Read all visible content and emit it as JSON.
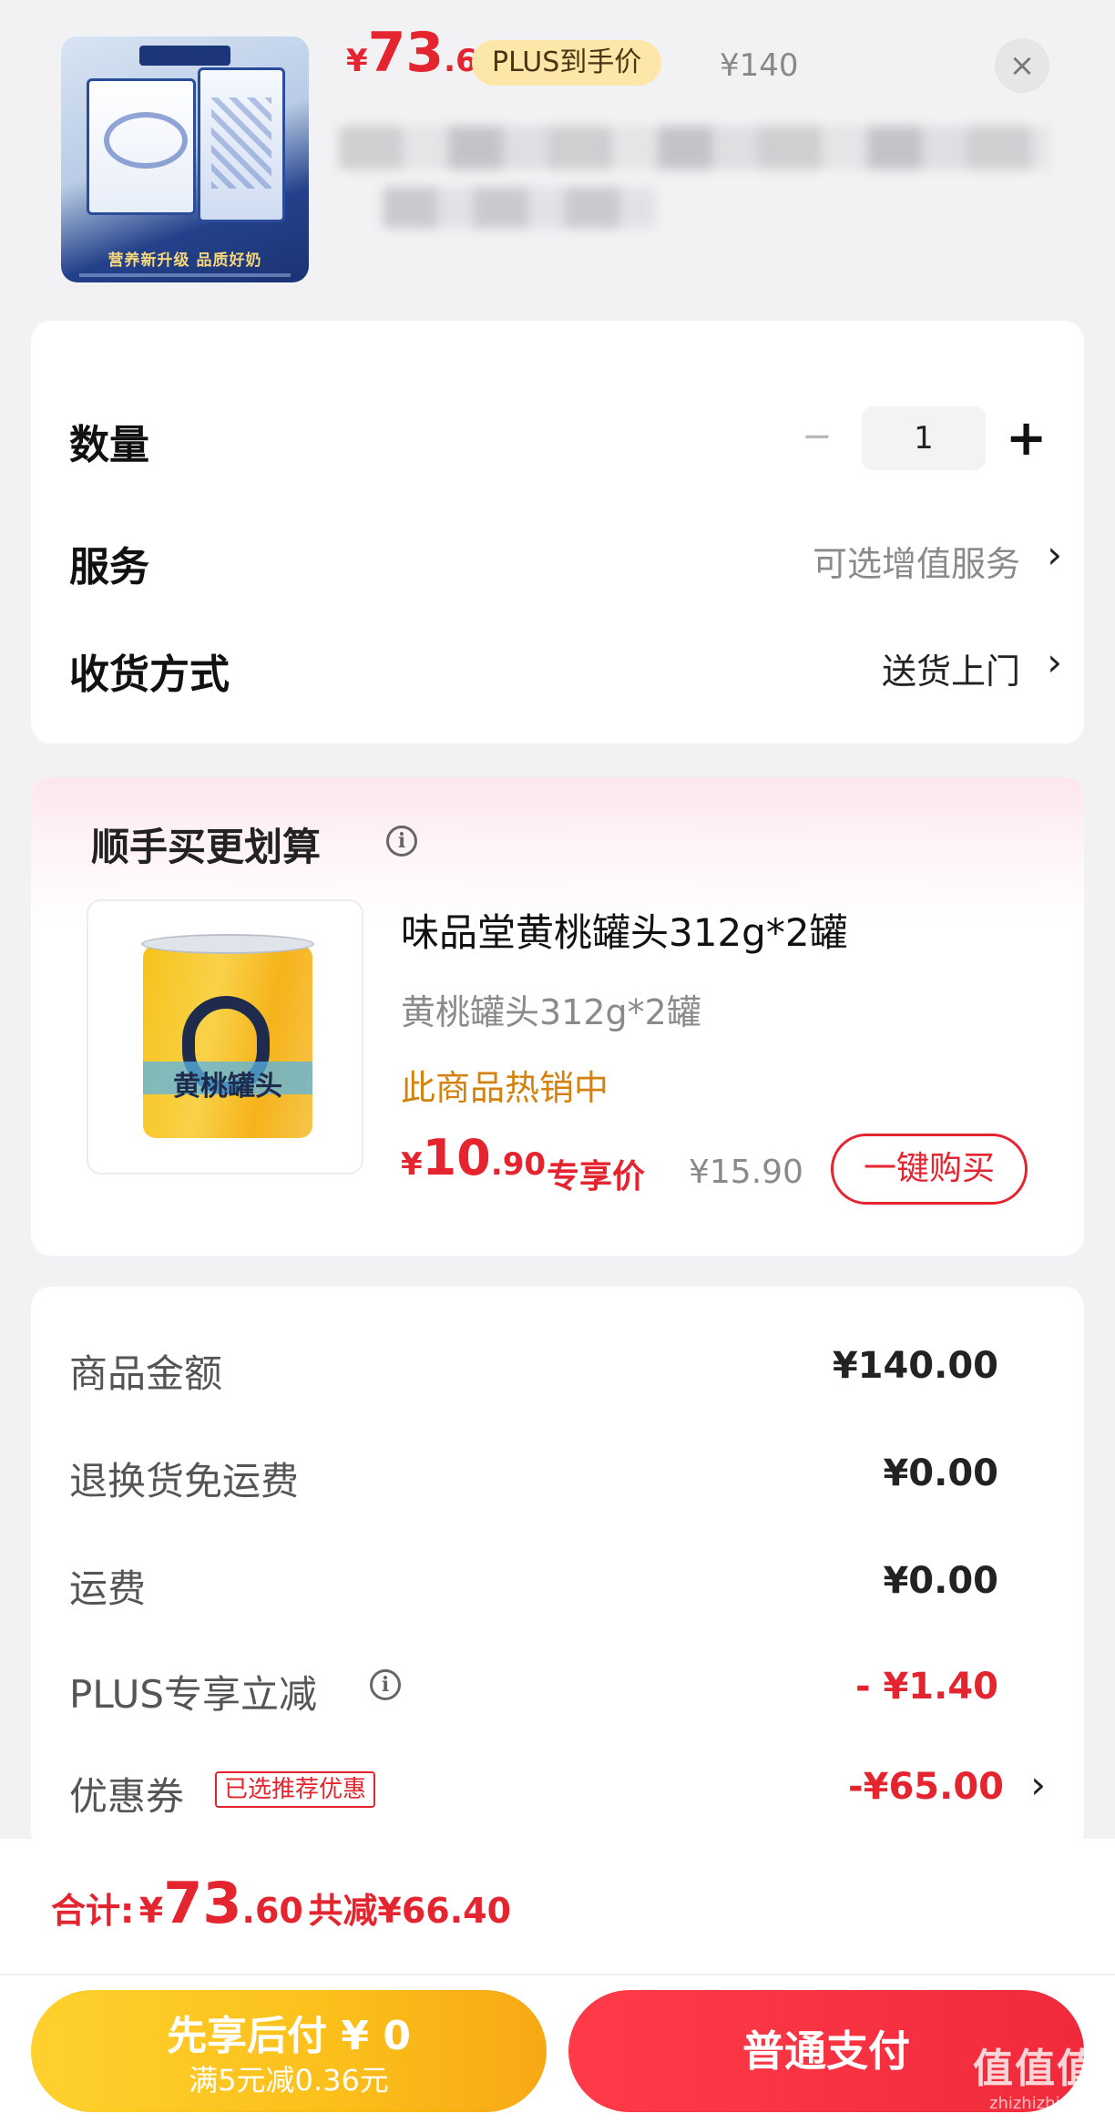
{
  "header": {
    "price": {
      "yen": "¥",
      "int": "73",
      "dec": ".6"
    },
    "plus_tag": "PLUS到手价",
    "original_price": "¥140",
    "close_icon": "×",
    "thumb_slogan": "营养新升级 品质好奶"
  },
  "options": {
    "quantity": {
      "label": "数量",
      "minus": "−",
      "value": "1",
      "plus": "+"
    },
    "service": {
      "label": "服务",
      "value": "可选增值服务",
      "chevron": "›"
    },
    "delivery": {
      "label": "收货方式",
      "value": "送货上门",
      "chevron": "›"
    }
  },
  "addon": {
    "title": "顺手买更划算",
    "info_icon": "i",
    "product": {
      "name": "味品堂黄桃罐头312g*2罐",
      "spec": "黄桃罐头312g*2罐",
      "hot": "此商品热销中",
      "price": {
        "yen": "¥",
        "int": "10",
        "dec": ".90"
      },
      "price_tag": "专享价",
      "original_price": "¥15.90",
      "buy_button": "一键购买",
      "can_text": "黄桃罐头"
    }
  },
  "summary": {
    "rows": [
      {
        "label": "商品金额",
        "value": "¥140.00"
      },
      {
        "label": "退换货免运费",
        "value": "¥0.00"
      },
      {
        "label": "运费",
        "value": "¥0.00"
      },
      {
        "label": "PLUS专享立减",
        "value": "- ¥1.40"
      },
      {
        "label": "优惠券",
        "value": "-¥65.00"
      }
    ],
    "coupon_tag": "已选推荐优惠",
    "chevron": "›"
  },
  "footer": {
    "total_label": "合计:",
    "total": {
      "yen": "¥",
      "int": "73",
      "dec": ".60"
    },
    "saved": "共减¥66.40",
    "later_pay": {
      "main": "先享后付 ¥ 0",
      "sub": "满5元减0.36元"
    },
    "pay_button": "普通支付",
    "watermark": "值值值",
    "watermark_sub": "zhizhizhi.com"
  },
  "colors": {
    "accent_red": "#e4242e",
    "plus_gold": "#fde7a8",
    "hot_orange": "#d4820f",
    "later_yellow": "#fbbf1a"
  }
}
